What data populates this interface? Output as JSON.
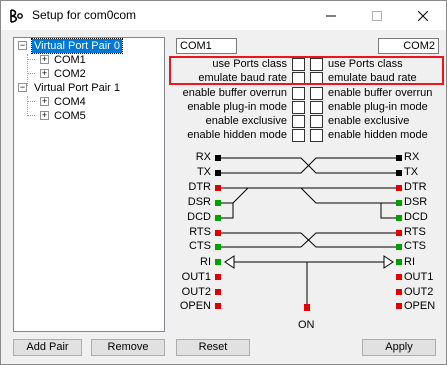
{
  "window": {
    "title": "Setup for com0com"
  },
  "tree": {
    "pairs": [
      {
        "label": "Virtual Port Pair 0",
        "ports": [
          "COM1",
          "COM2"
        ]
      },
      {
        "label": "Virtual Port Pair 1",
        "ports": [
          "COM4",
          "COM5"
        ]
      }
    ]
  },
  "ports": {
    "a": "COM1",
    "b": "COM2"
  },
  "options": [
    {
      "left": "use Ports class",
      "right": "use Ports class"
    },
    {
      "left": "emulate baud rate",
      "right": "emulate baud rate"
    },
    {
      "left": "enable buffer overrun",
      "right": "enable buffer overrun"
    },
    {
      "left": "enable plug-in mode",
      "right": "enable plug-in mode"
    },
    {
      "left": "enable exclusive",
      "right": "enable exclusive"
    },
    {
      "left": "enable hidden mode",
      "right": "enable hidden mode"
    }
  ],
  "signals": {
    "left": [
      {
        "label": "RX",
        "color": "#000000"
      },
      {
        "label": "TX",
        "color": "#000000"
      },
      {
        "label": "DTR",
        "color": "#e00000"
      },
      {
        "label": "DSR",
        "color": "#00a000"
      },
      {
        "label": "DCD",
        "color": "#00a000"
      },
      {
        "label": "RTS",
        "color": "#e00000"
      },
      {
        "label": "CTS",
        "color": "#00a000"
      },
      {
        "label": "RI",
        "color": "#00a000"
      },
      {
        "label": "OUT1",
        "color": "#e00000"
      },
      {
        "label": "OUT2",
        "color": "#e00000"
      },
      {
        "label": "OPEN",
        "color": "#e00000"
      }
    ],
    "right": [
      {
        "label": "RX",
        "color": "#000000"
      },
      {
        "label": "TX",
        "color": "#000000"
      },
      {
        "label": "DTR",
        "color": "#e00000"
      },
      {
        "label": "DSR",
        "color": "#00a000"
      },
      {
        "label": "DCD",
        "color": "#00a000"
      },
      {
        "label": "RTS",
        "color": "#e00000"
      },
      {
        "label": "CTS",
        "color": "#00a000"
      },
      {
        "label": "RI",
        "color": "#00a000"
      },
      {
        "label": "OUT1",
        "color": "#e00000"
      },
      {
        "label": "OUT2",
        "color": "#e00000"
      },
      {
        "label": "OPEN",
        "color": "#e00000"
      }
    ],
    "center_label": "ON"
  },
  "buttons": {
    "add_pair": "Add Pair",
    "remove": "Remove",
    "reset": "Reset",
    "apply": "Apply"
  },
  "colors": {
    "highlight": "#e8171e",
    "selection": "#0078d7"
  }
}
